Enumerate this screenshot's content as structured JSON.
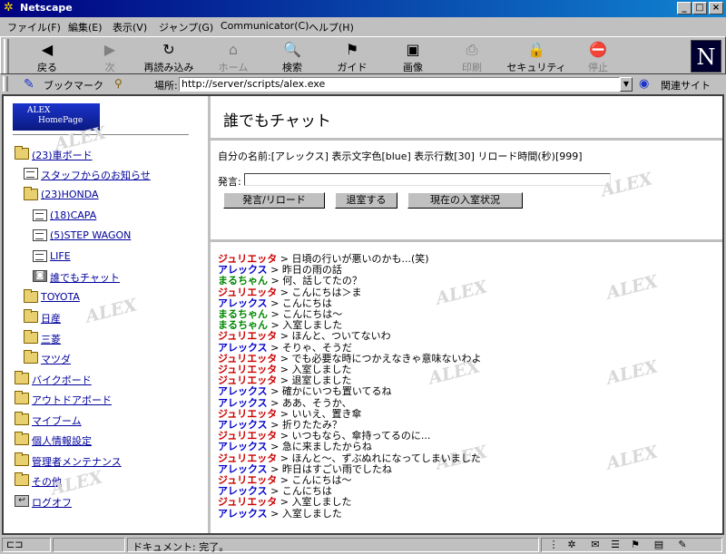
{
  "window": {
    "title": "Netscape",
    "minimize": "_",
    "maximize": "□",
    "close": "×"
  },
  "menu": [
    "ファイル(F)",
    "編集(E)",
    "表示(V)",
    "ジャンプ(G)",
    "Communicator(C)",
    "ヘルプ(H)"
  ],
  "toolbar": {
    "buttons": [
      {
        "label": "戻る",
        "icon": "back-arrow-icon",
        "glyph": "◀",
        "enabled": true
      },
      {
        "label": "次",
        "icon": "forward-arrow-icon",
        "glyph": "▶",
        "enabled": false
      },
      {
        "label": "再読み込み",
        "icon": "reload-icon",
        "glyph": "↻",
        "enabled": true
      },
      {
        "label": "ホーム",
        "icon": "home-icon",
        "glyph": "⌂",
        "enabled": false
      },
      {
        "label": "検索",
        "icon": "search-icon",
        "glyph": "🔍",
        "enabled": true
      },
      {
        "label": "ガイド",
        "icon": "guide-icon",
        "glyph": "⚑",
        "enabled": true
      },
      {
        "label": "画像",
        "icon": "images-icon",
        "glyph": "▣",
        "enabled": true
      },
      {
        "label": "印刷",
        "icon": "print-icon",
        "glyph": "⎙",
        "enabled": false
      },
      {
        "label": "セキュリティ",
        "icon": "security-lock-icon",
        "glyph": "🔒",
        "enabled": true
      },
      {
        "label": "停止",
        "icon": "stop-icon",
        "glyph": "⛔",
        "enabled": false
      }
    ],
    "logo": "N"
  },
  "location": {
    "bookmarks_label": "ブックマーク",
    "location_label": "場所:",
    "url": "http://server/scripts/alex.exe",
    "related_label": "関連サイト"
  },
  "sidebar": {
    "logo_line1": "ALEX",
    "logo_line2": "HomePage",
    "items": [
      {
        "label": "(23)車ボード",
        "icon": "folder"
      },
      {
        "label": "スタッフからのお知らせ",
        "icon": "doc"
      },
      {
        "label": "(23)HONDA",
        "icon": "folder"
      },
      {
        "label": "(18)CAPA",
        "icon": "doc"
      },
      {
        "label": "(5)STEP WAGON",
        "icon": "doc"
      },
      {
        "label": "LIFE",
        "icon": "doc"
      },
      {
        "label": "誰でもチャット",
        "icon": "chat"
      },
      {
        "label": "TOYOTA",
        "icon": "folder"
      },
      {
        "label": "日産",
        "icon": "folder"
      },
      {
        "label": "三菱",
        "icon": "folder"
      },
      {
        "label": "マツダ",
        "icon": "folder"
      },
      {
        "label": "バイクボード",
        "icon": "folder"
      },
      {
        "label": "アウトドアボード",
        "icon": "folder"
      },
      {
        "label": "マイブーム",
        "icon": "folder"
      },
      {
        "label": "個人情報設定",
        "icon": "folder"
      },
      {
        "label": "管理者メンテナンス",
        "icon": "folder"
      },
      {
        "label": "その他",
        "icon": "folder"
      },
      {
        "label": "ログオフ",
        "icon": "logoff"
      }
    ]
  },
  "chat": {
    "title": "誰でもチャット",
    "status": "自分の名前:[アレックス]  表示文字色[blue]  表示行数[30]  リロード時間(秒)[999]",
    "message_label": "発言:",
    "message_value": "",
    "buttons": {
      "send": "発言/リロード",
      "leave": "退室する",
      "status": "現在の入室状況"
    },
    "colors": {
      "ジュリエッタ": "#cc0000",
      "アレックス": "#0000cc",
      "まるちゃん": "#008800"
    },
    "log": [
      {
        "name": "ジュリエッタ",
        "text": "日頃の行いが悪いのかも...(笑)"
      },
      {
        "name": "アレックス",
        "text": "昨日の雨の話"
      },
      {
        "name": "まるちゃん",
        "text": "何、話してたの？"
      },
      {
        "name": "ジュリエッタ",
        "text": "こんにちは＞ま"
      },
      {
        "name": "アレックス",
        "text": "こんにちは"
      },
      {
        "name": "まるちゃん",
        "text": "こんにちは～"
      },
      {
        "name": "まるちゃん",
        "text": "入室しました"
      },
      {
        "name": "ジュリエッタ",
        "text": "ほんと、ついてないわ"
      },
      {
        "name": "アレックス",
        "text": "そりゃ、そうだ"
      },
      {
        "name": "ジュリエッタ",
        "text": "でも必要な時につかえなきゃ意味ないわよ"
      },
      {
        "name": "ジュリエッタ",
        "text": "入室しました"
      },
      {
        "name": "ジュリエッタ",
        "text": "退室しました"
      },
      {
        "name": "アレックス",
        "text": "確かにいつも置いてるね"
      },
      {
        "name": "アレックス",
        "text": "ああ、そうか、"
      },
      {
        "name": "ジュリエッタ",
        "text": "いいえ、置き傘"
      },
      {
        "name": "アレックス",
        "text": "折りたたみ？"
      },
      {
        "name": "ジュリエッタ",
        "text": "いつもなら、傘持ってるのに..."
      },
      {
        "name": "アレックス",
        "text": "急に来ましたからね"
      },
      {
        "name": "ジュリエッタ",
        "text": "ほんと～、ずぶぬれになってしまいました"
      },
      {
        "name": "アレックス",
        "text": "昨日はすごい雨でしたね"
      },
      {
        "name": "ジュリエッタ",
        "text": "こんにちは～"
      },
      {
        "name": "アレックス",
        "text": "こんにちは"
      },
      {
        "name": "ジュリエッタ",
        "text": "入室しました"
      },
      {
        "name": "アレックス",
        "text": "入室しました"
      }
    ]
  },
  "watermark": "ALEX",
  "statusbar": {
    "text": "ドキュメント: 完了。"
  }
}
